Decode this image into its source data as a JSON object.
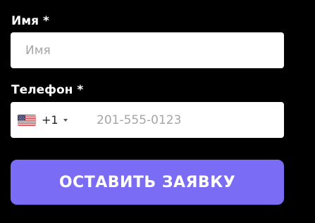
{
  "form": {
    "name_label": "Имя *",
    "name_placeholder": "Имя",
    "phone_label": "Телефон *",
    "phone_placeholder": "201-555-0123",
    "country": {
      "flag": "us-flag-icon",
      "dial_code": "+1"
    },
    "submit_label": "ОСТАВИТЬ ЗАЯВКУ"
  },
  "colors": {
    "background": "#000000",
    "input_background": "#ffffff",
    "placeholder": "#a5a5a5",
    "button": "#7b6cf6",
    "button_text": "#ffffff"
  }
}
